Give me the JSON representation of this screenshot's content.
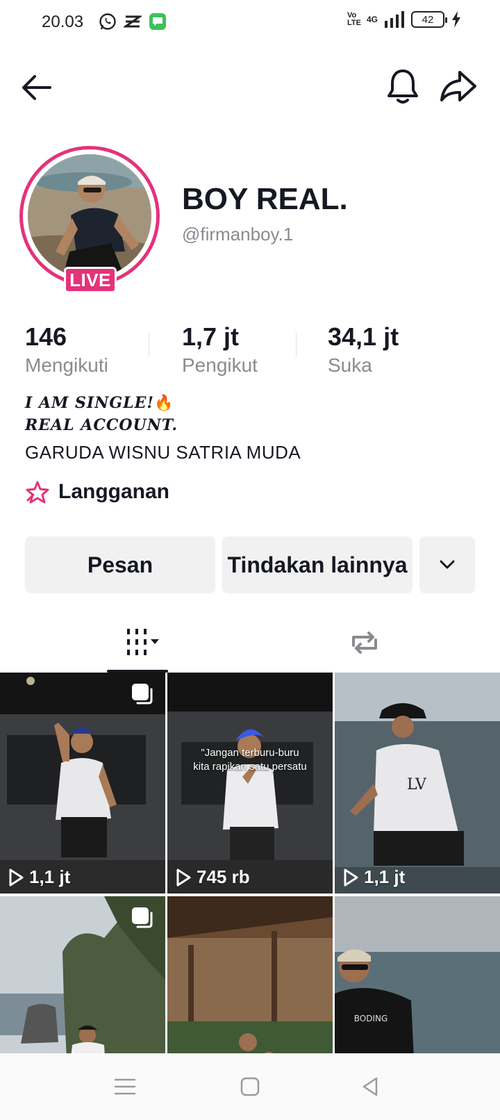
{
  "status_bar": {
    "time": "20.03",
    "network": "4G",
    "volte": "Vo LTE",
    "battery": "42",
    "icons": [
      "whatsapp-icon",
      "capcut-icon",
      "messages-icon",
      "signal-icon",
      "charging-icon"
    ]
  },
  "header": {
    "icons": [
      "back-arrow-icon",
      "bell-icon",
      "share-icon"
    ]
  },
  "profile": {
    "display_name": "BOY REAL.",
    "username": "@firmanboy.1",
    "live_label": "LIVE",
    "accent_color": "#e3337a"
  },
  "stats": [
    {
      "value": "146",
      "label": "Mengikuti"
    },
    {
      "value": "1,7 jt",
      "label": "Pengikut"
    },
    {
      "value": "34,1 jt",
      "label": "Suka"
    }
  ],
  "bio": {
    "line1": "I AM SINGLE!",
    "line1_emoji": "🔥",
    "line2": "REAL ACCOUNT.",
    "line3": "GARUDA WISNU SATRIA MUDA"
  },
  "subscription": {
    "label": "Langganan"
  },
  "actions": {
    "message_label": "Pesan",
    "more_label": "Tindakan lainnya"
  },
  "tabs": {
    "icons": [
      "videos-grid-icon",
      "reposts-icon"
    ]
  },
  "videos": [
    {
      "views": "1,1 jt",
      "multi": true,
      "caption": ""
    },
    {
      "views": "745 rb",
      "multi": false,
      "caption_line1": "\"Jangan terburu-buru",
      "caption_line2": "kita rapikan satu persatu"
    },
    {
      "views": "1,1 jt",
      "multi": false,
      "caption": ""
    },
    {
      "views": "",
      "multi": true,
      "caption": ""
    },
    {
      "views": "",
      "multi": false,
      "caption": ""
    },
    {
      "views": "",
      "multi": false,
      "caption": ""
    }
  ],
  "nav": {
    "icons": [
      "menu-icon",
      "home-icon",
      "back-icon"
    ]
  }
}
